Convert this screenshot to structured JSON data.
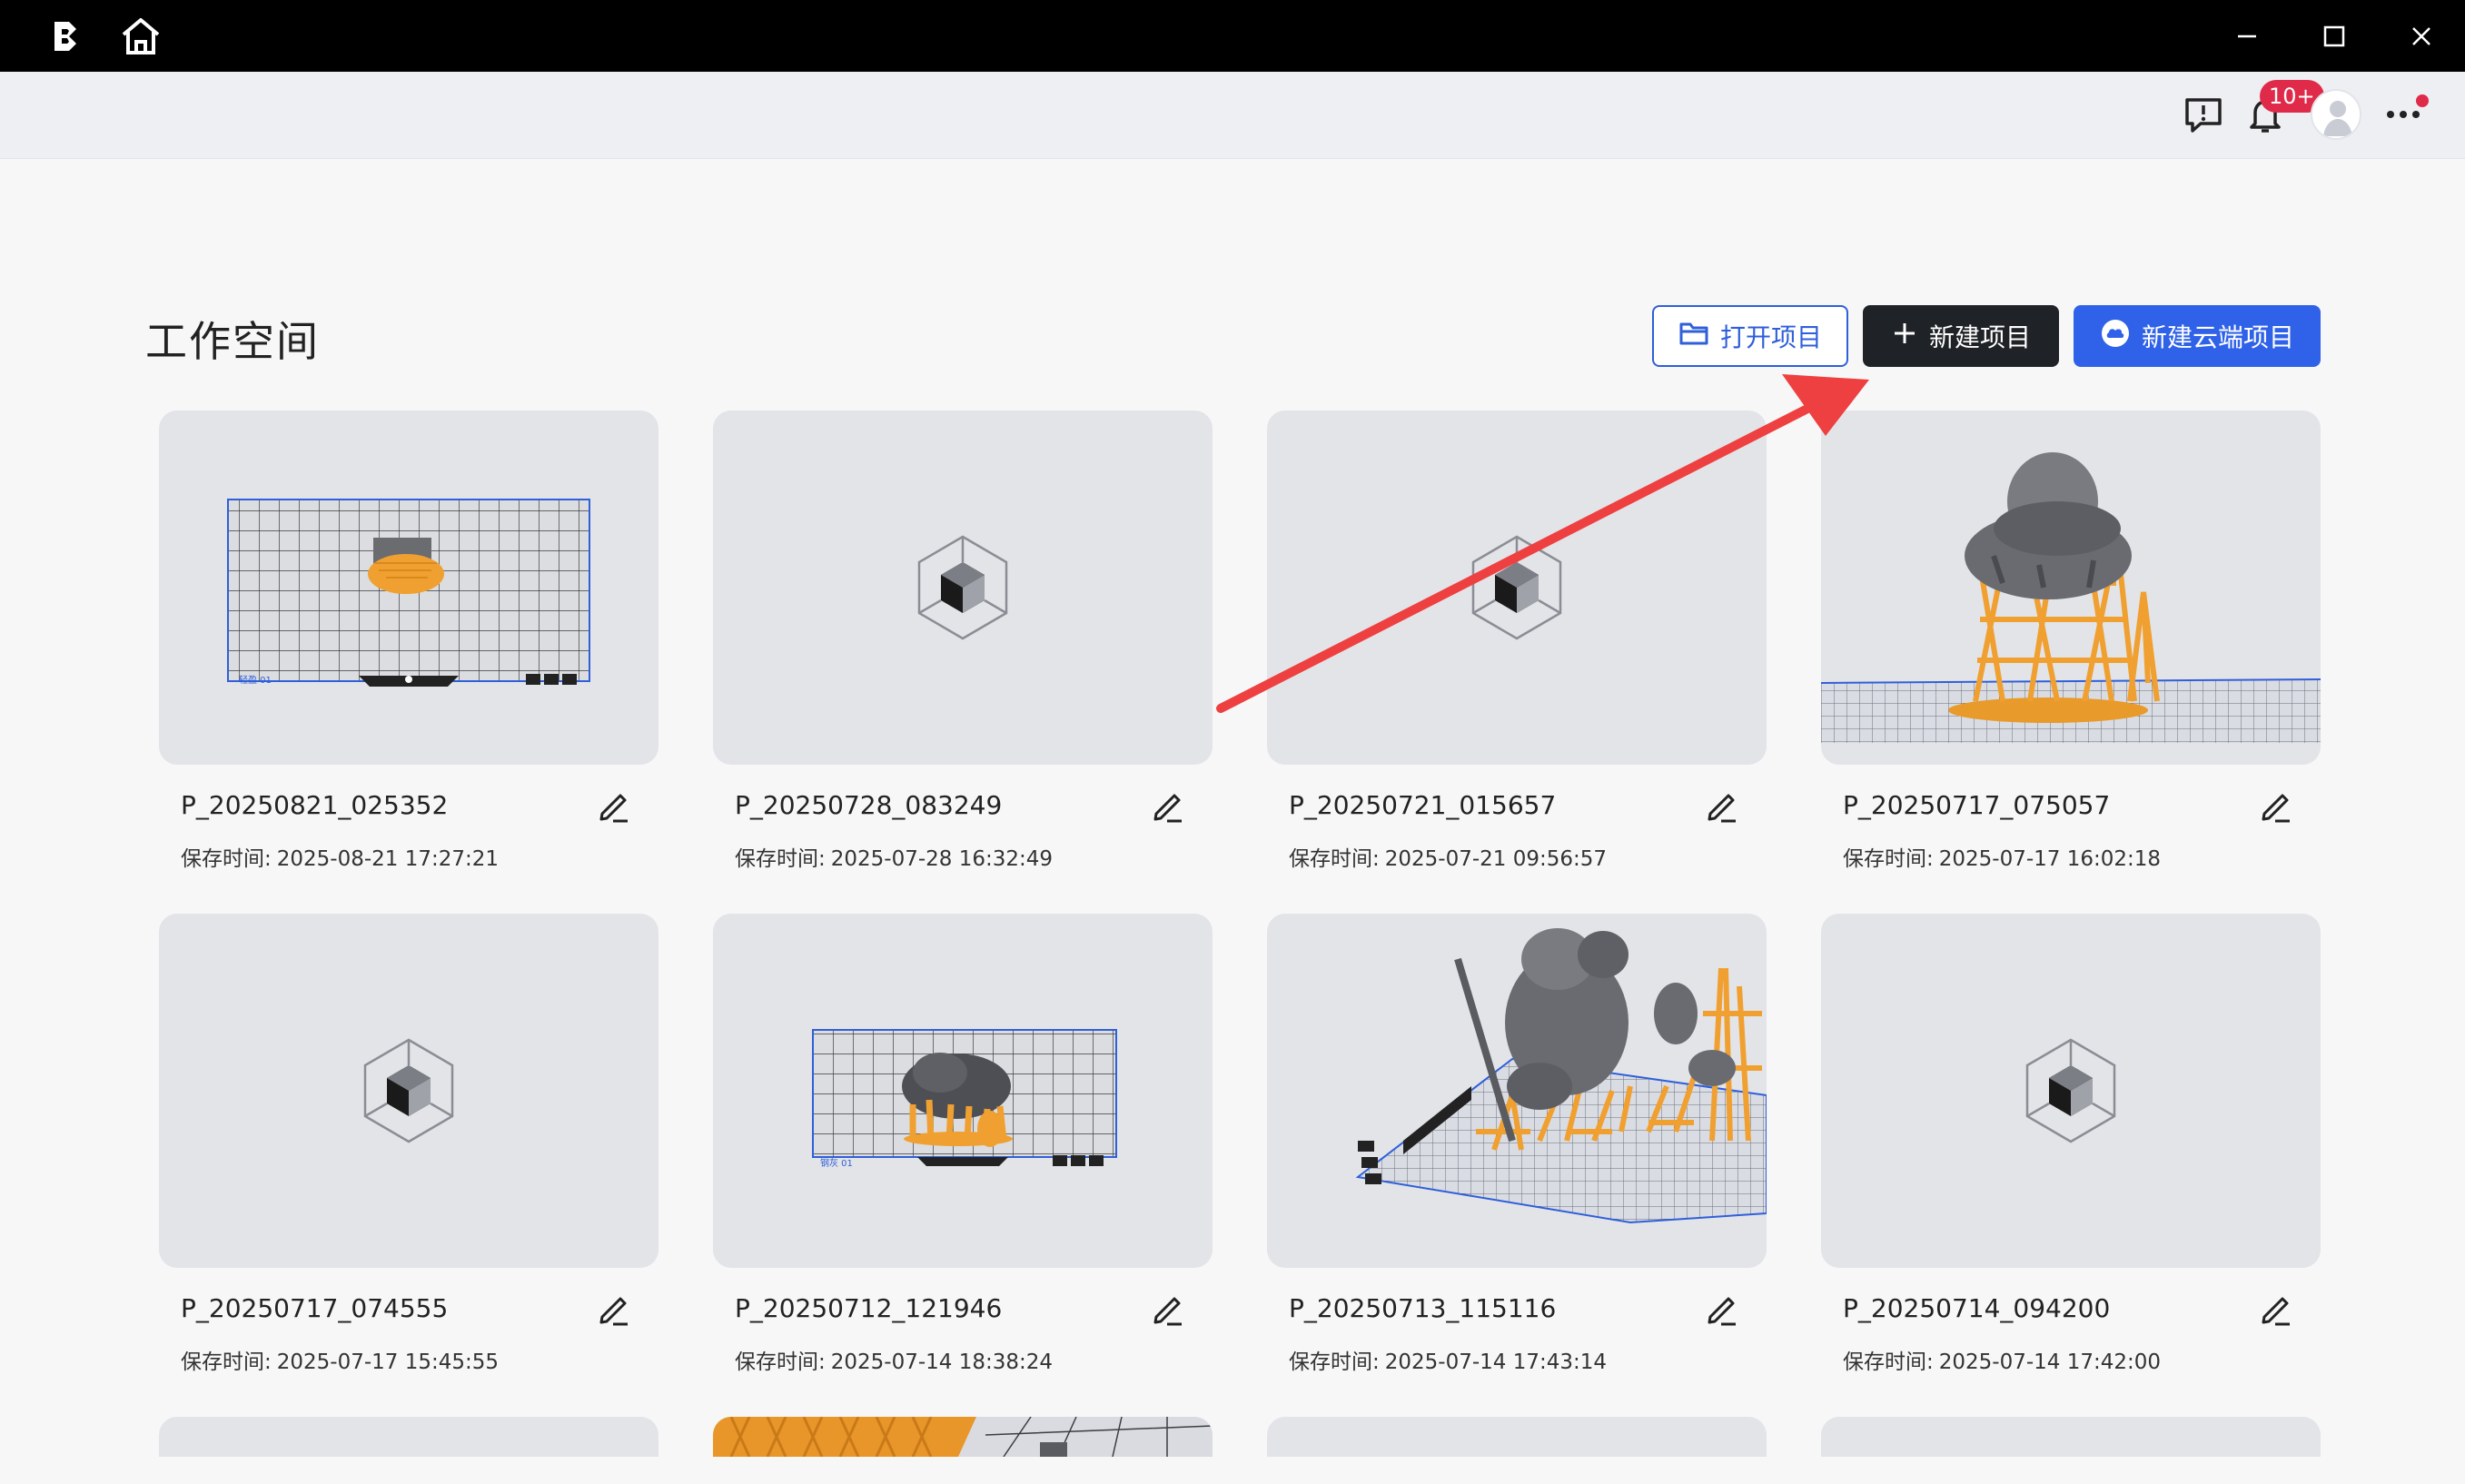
{
  "window": {
    "logo_icon": "app-logo-icon",
    "home_icon": "home-icon",
    "controls": [
      "minimize-icon",
      "maximize-icon",
      "close-icon"
    ]
  },
  "header": {
    "feedback_icon": "feedback-icon",
    "bell_icon": "bell-icon",
    "notification_badge": "10+",
    "more_icon": "more-horizontal-icon"
  },
  "workspace": {
    "title": "工作空间",
    "buttons": {
      "open": "打开项目",
      "new": "新建项目",
      "cloud": "新建云端项目"
    }
  },
  "colors": {
    "primary_blue": "#2f62e8",
    "dark_button": "#1f2226",
    "badge_red": "#e02a4a",
    "annotation_red": "#ee4040",
    "resin_orange": "#f0a030"
  },
  "time_label": "保存时间:",
  "projects": [
    {
      "name": "P_20250821_025352",
      "time": "2025-08-21 17:27:21",
      "thumb": "plate-small-model"
    },
    {
      "name": "P_20250728_083249",
      "time": "2025-07-28 16:32:49",
      "thumb": "placeholder-cube"
    },
    {
      "name": "P_20250721_015657",
      "time": "2025-07-21 09:56:57",
      "thumb": "placeholder-cube"
    },
    {
      "name": "P_20250717_075057",
      "time": "2025-07-17 16:02:18",
      "thumb": "supported-figure"
    },
    {
      "name": "P_20250717_074555",
      "time": "2025-07-17 15:45:55",
      "thumb": "placeholder-cube"
    },
    {
      "name": "P_20250712_121946",
      "time": "2025-07-14 18:38:24",
      "thumb": "plate-model"
    },
    {
      "name": "P_20250713_115116",
      "time": "2025-07-14 17:43:14",
      "thumb": "plate-3d-figures"
    },
    {
      "name": "P_20250714_094200",
      "time": "2025-07-14 17:42:00",
      "thumb": "placeholder-cube"
    }
  ],
  "plate_labels": {
    "p1": "轻盈 01",
    "p6": "钢灰 01"
  }
}
